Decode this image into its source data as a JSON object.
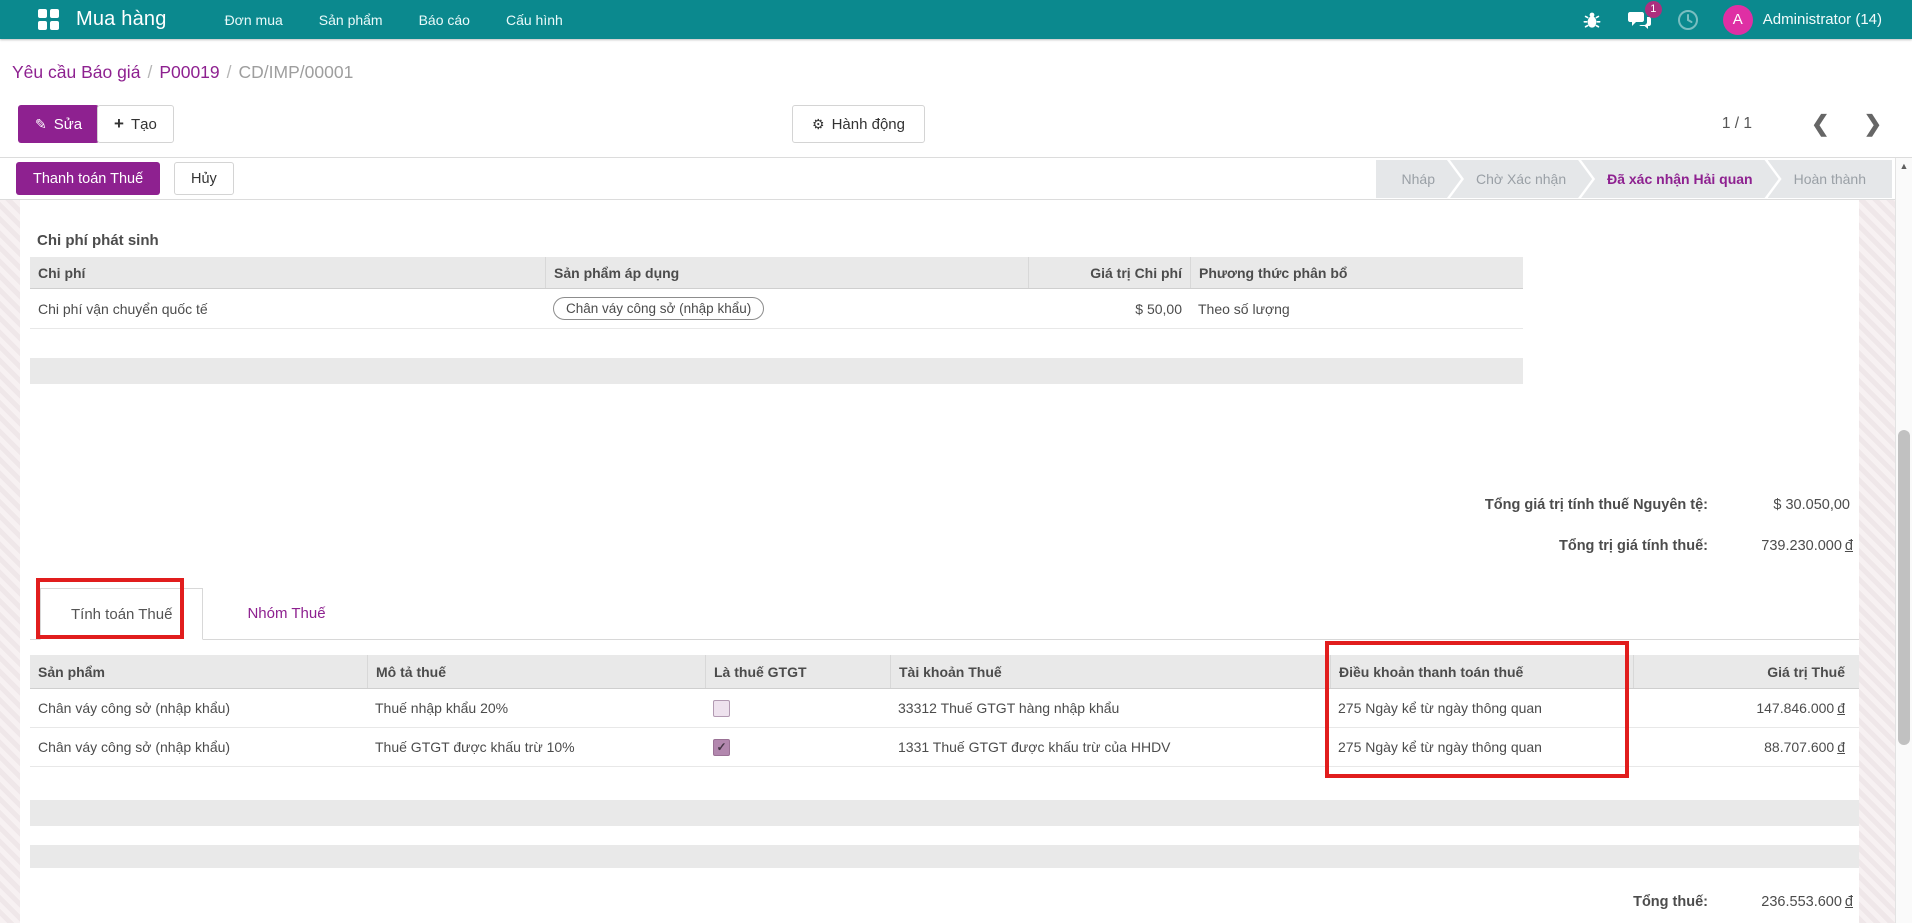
{
  "topbar": {
    "app_name": "Mua hàng",
    "menu": [
      "Đơn mua",
      "Sản phẩm",
      "Báo cáo",
      "Cấu hình"
    ],
    "badge": "1",
    "avatar_letter": "A",
    "user": "Administrator (14)"
  },
  "breadcrumb": {
    "link1": "Yêu cầu Báo giá",
    "link2": "P00019",
    "current": "CD/IMP/00001",
    "separator": "/"
  },
  "actions": {
    "edit": "Sửa",
    "create": "Tạo",
    "action_menu": "Hành động",
    "pager": "1 / 1"
  },
  "icons": {
    "edit": "✎",
    "create": "+",
    "gear": "⚙",
    "prev": "❮",
    "next": "❯",
    "scroll_up": "▲",
    "check": "✓"
  },
  "statusbar": {
    "buttons": [
      {
        "label": "Thanh toán Thuế"
      },
      {
        "label": "Hủy"
      }
    ],
    "stages": [
      {
        "label": "Nháp",
        "active": "false"
      },
      {
        "label": "Chờ Xác nhận",
        "active": "false"
      },
      {
        "label": "Đã xác nhận Hải quan",
        "active": "true"
      },
      {
        "label": "Hoàn thành",
        "active": "false"
      }
    ]
  },
  "cost_section": {
    "title": "Chi phí phát sinh",
    "headers": [
      "Chi phí",
      "Sản phẩm áp dụng",
      "Giá trị Chi phí",
      "Phương thức phân bổ"
    ],
    "rows": [
      {
        "cost": "Chi phí vận chuyển quốc tế",
        "product_tag": "Chân váy công sở (nhập khẩu)",
        "value": "$ 50,00",
        "method": "Theo số lượng"
      }
    ]
  },
  "totals_upper": [
    {
      "label": "Tổng giá trị tính thuế Nguyên tệ:",
      "value": "$ 30.050,00",
      "suffix": ""
    },
    {
      "label": "Tổng trị giá tính thuế:",
      "value": "739.230.000",
      "suffix": "đ"
    }
  ],
  "tabs": [
    {
      "label": "Tính toán Thuế",
      "active": "true"
    },
    {
      "label": "Nhóm Thuế",
      "active": "false"
    }
  ],
  "tax_table": {
    "headers": [
      "Sản phẩm",
      "Mô tả thuế",
      "Là thuế GTGT",
      "Tài khoản Thuế",
      "Điều khoản thanh toán thuế",
      "Giá trị Thuế"
    ],
    "rows": [
      {
        "product": "Chân váy công sở (nhập khẩu)",
        "desc": "Thuế nhập khẩu 20%",
        "gtgt": "false",
        "account": "33312 Thuế GTGT hàng nhập khẩu",
        "term": "275 Ngày kể từ ngày thông quan",
        "value": "147.846.000",
        "suffix": "đ"
      },
      {
        "product": "Chân váy công sở (nhập khẩu)",
        "desc": "Thuế GTGT được khấu trừ 10%",
        "gtgt": "true",
        "account": "1331 Thuế GTGT được khấu trừ của HHDV",
        "term": "275 Ngày kể từ ngày thông quan",
        "value": "88.707.600",
        "suffix": "đ"
      }
    ]
  },
  "totals_lower": [
    {
      "label": "Tổng thuế:",
      "value": "236.553.600",
      "suffix": "đ"
    }
  ],
  "colors": {
    "topbar_teal": "#0b898e",
    "primary_purple": "#8e2190",
    "avatar_pink": "#df2fa4",
    "badge_magenta": "#ac2f7e",
    "annotation_red": "#e11d1d",
    "table_header_gray": "#e9e9e9",
    "text_dark": "#4c4c4c",
    "text_muted": "#9aa0a6"
  }
}
